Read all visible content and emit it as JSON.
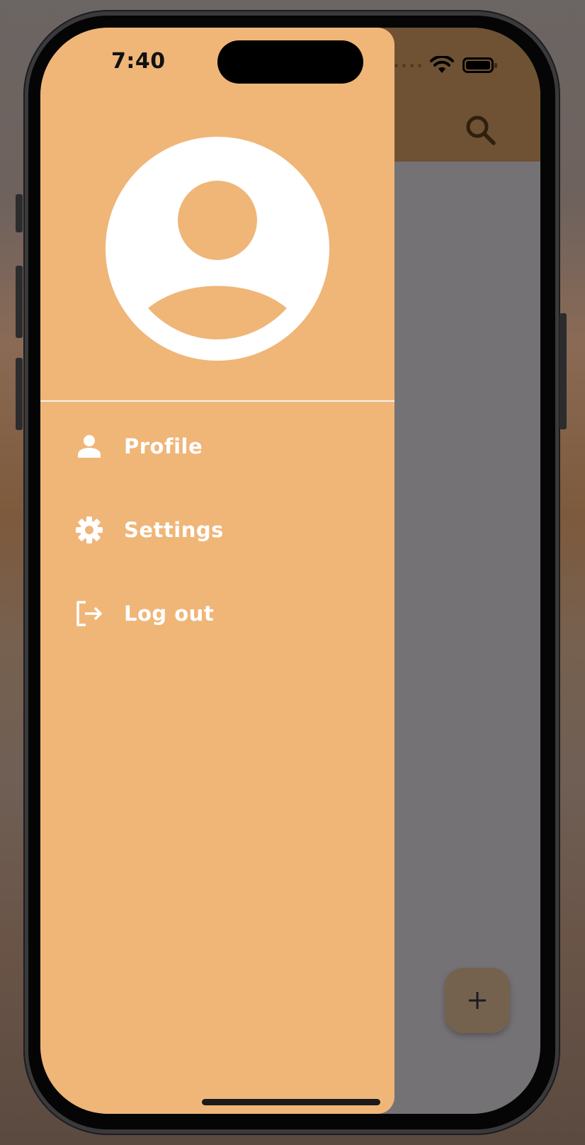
{
  "status_bar": {
    "time": "7:40"
  },
  "app_bar": {
    "search_icon": "search-icon",
    "background_color": "#6f5133"
  },
  "drawer": {
    "background_color": "#efb678",
    "avatar_icon": "account-circle-icon",
    "items": [
      {
        "label": "Profile",
        "icon": "person-icon"
      },
      {
        "label": "Settings",
        "icon": "gear-icon"
      },
      {
        "label": "Log out",
        "icon": "logout-icon"
      }
    ]
  },
  "fab": {
    "label": "+",
    "icon": "plus-icon"
  }
}
